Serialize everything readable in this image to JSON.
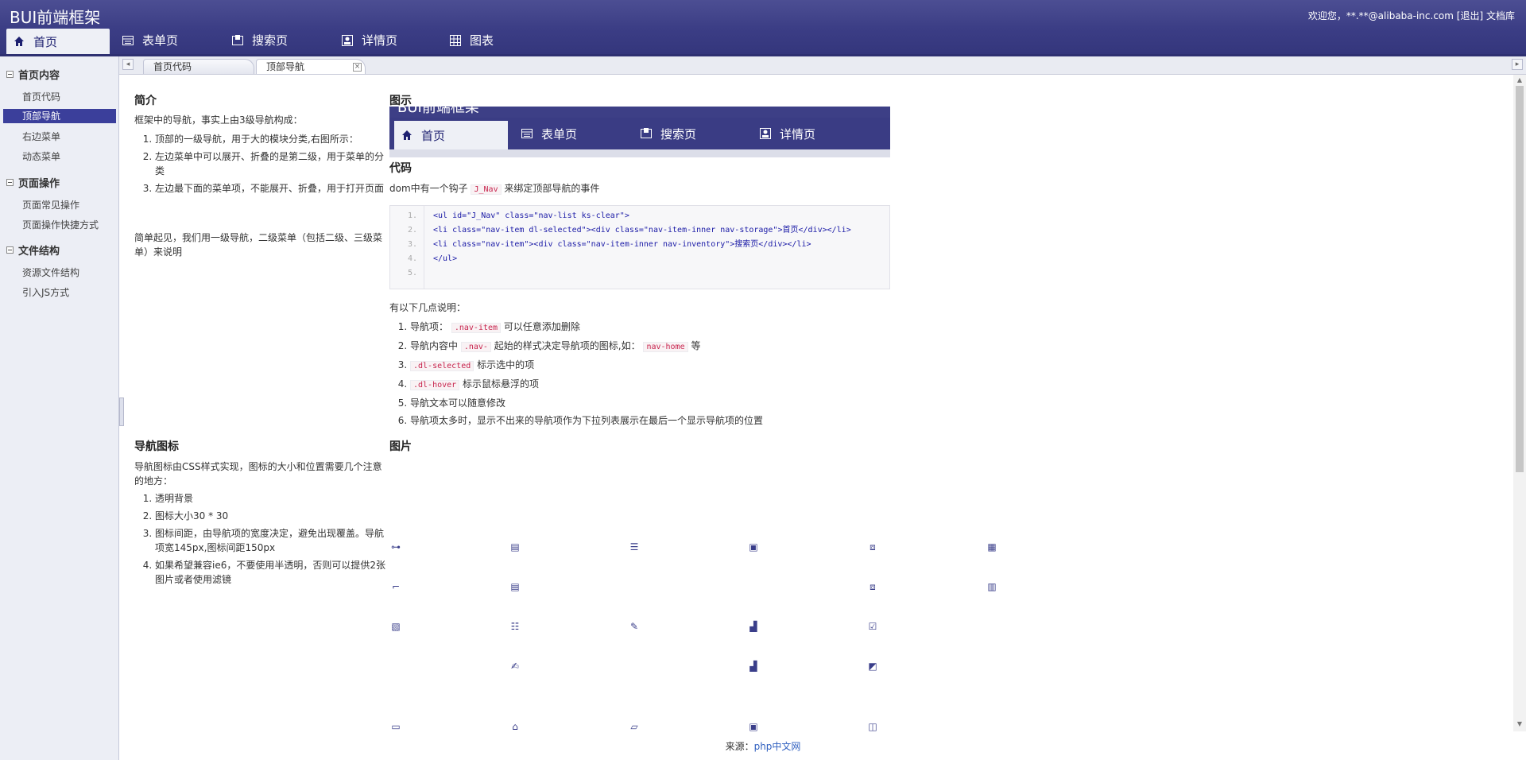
{
  "app": {
    "title": "BUI前端框架"
  },
  "user": {
    "welcome": "欢迎您，**.**@alibaba-inc.com",
    "logout": "[退出]",
    "docs": "文档库"
  },
  "nav": {
    "items": [
      {
        "label": "首页",
        "icon": "home-icon"
      },
      {
        "label": "表单页",
        "icon": "table-icon"
      },
      {
        "label": "搜索页",
        "icon": "search-page-icon"
      },
      {
        "label": "详情页",
        "icon": "detail-icon"
      },
      {
        "label": "图表",
        "icon": "chart-grid-icon"
      }
    ]
  },
  "sidebar": {
    "groups": [
      {
        "title": "首页内容",
        "items": [
          "首页代码",
          "顶部导航",
          "右边菜单",
          "动态菜单"
        ]
      },
      {
        "title": "页面操作",
        "items": [
          "页面常见操作",
          "页面操作快捷方式"
        ]
      },
      {
        "title": "文件结构",
        "items": [
          "资源文件结构",
          "引入JS方式"
        ]
      }
    ],
    "selected": "顶部导航"
  },
  "tabs": {
    "items": [
      "首页代码",
      "顶部导航"
    ],
    "active": "顶部导航"
  },
  "intro": {
    "title": "简介",
    "lead": "框架中的导航，事实上由3级导航构成：",
    "points": [
      "顶部的一级导航，用于大的模块分类,右图所示：",
      "左边菜单中可以展开、折叠的是第二级，用于菜单的分类",
      "左边最下面的菜单项，不能展开、折叠，用于打开页面"
    ],
    "summary": "简单起见，我们用一级导航，二级菜单（包括二级、三级菜单）来说明"
  },
  "figure": {
    "title": "图示",
    "demo_title": "BUI前端框架",
    "demo_nav": [
      "首页",
      "表单页",
      "搜索页",
      "详情页"
    ]
  },
  "code": {
    "title": "代码",
    "desc_pre": "dom中有一个钩子",
    "hook": "J_Nav",
    "desc_post": "来绑定顶部导航的事件",
    "line_numbers": [
      "1.",
      "2.",
      "3.",
      "4.",
      "5."
    ],
    "lines": [
      "<ul id=\"J_Nav\"  class=\"nav-list ks-clear\">",
      "<li class=\"nav-item dl-selected\"><div class=\"nav-item-inner nav-storage\">首页</div></li>",
      "<li class=\"nav-item\"><div class=\"nav-item-inner nav-inventory\">搜索页</div></li>",
      "</ul>",
      ""
    ]
  },
  "notes": {
    "lead": "有以下几点说明：",
    "items": [
      {
        "code": ".nav-item",
        "pre": "导航项：",
        "post": "可以任意添加删除"
      },
      {
        "pre": "导航内容中",
        "code": ".nav-",
        "mid": "起始的样式决定导航项的图标,如：",
        "code2": "nav-home",
        "post": "等"
      },
      {
        "code": ".dl-selected",
        "post": "标示选中的项"
      },
      {
        "code": ".dl-hover",
        "post": "标示鼠标悬浮的项"
      },
      {
        "pre": "导航文本可以随意修改"
      },
      {
        "pre": "导航项太多时，显示不出来的导航项作为下拉列表展示在最后一个显示导航项的位置"
      }
    ]
  },
  "nav_icons": {
    "title": "导航图标",
    "lead": "导航图标由CSS样式实现，图标的大小和位置需要几个注意的地方：",
    "points": [
      "透明背景",
      "图标大小30 * 30",
      "图标间距，由导航项的宽度决定，避免出现覆盖。导航项宽145px,图标间距150px",
      "如果希望兼容ie6，不要使用半透明，否则可以提供2张图片或者使用滤镜"
    ]
  },
  "pictures": {
    "title": "图片"
  },
  "footer": {
    "source_label": "来源：",
    "source_link": "php中文网"
  },
  "colors": {
    "header": "#3d3f86",
    "selected": "#3b3f9b",
    "code_string": "#b0365a",
    "code_tag": "#1a1aa6"
  }
}
